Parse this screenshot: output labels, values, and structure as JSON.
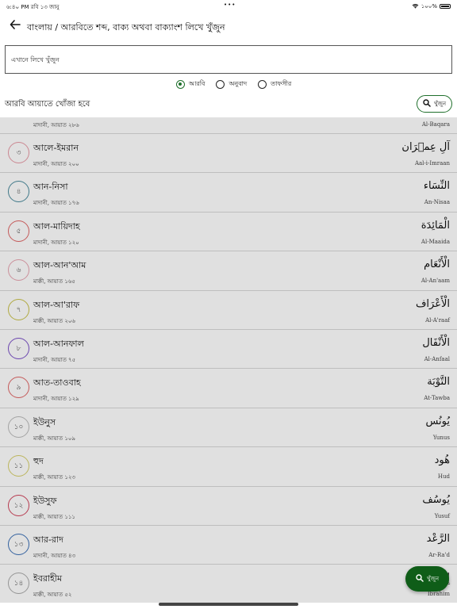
{
  "status_bar": {
    "time": "৬:৪০ PM  রবি ১৩ জানু",
    "dots": "•••",
    "battery": "১০০%"
  },
  "header": {
    "title": "বাংলায় / আরবিতে শব্দ, বাক্য অথবা বাক্যাংশ লিখে খুঁজুন"
  },
  "search": {
    "placeholder": "এখানে লিখে খুঁজুন",
    "value": ""
  },
  "options": [
    {
      "label": "আরবি",
      "selected": true
    },
    {
      "label": "অনুবাদ",
      "selected": false
    },
    {
      "label": "তাফসীর",
      "selected": false
    }
  ],
  "hint": "আরবি আয়াতে খোঁজা হবে",
  "search_button_label": "খুঁজুন",
  "fab_label": "খুঁজুন",
  "partial_row": {
    "meta": "মাদানী, আয়াত ২৮৬",
    "translit": "Al-Baqara"
  },
  "surahs": [
    {
      "number": "৩",
      "name": "আলে-ইমরান",
      "meta": "মাদানী, আয়াত ২০০",
      "arabic": "آلِ عِمۡرَان",
      "translit": "Aal-i-Imraan",
      "color": "#e79aa6"
    },
    {
      "number": "৪",
      "name": "আন-নিসা",
      "meta": "মাদানী, আয়াত ১৭৬",
      "arabic": "النِّسَاء",
      "translit": "An-Nisaa",
      "color": "#4a8a9c"
    },
    {
      "number": "৫",
      "name": "আল-মায়িদাহ",
      "meta": "মাদানী, আয়াত ১২০",
      "arabic": "الْمَائِدَة",
      "translit": "Al-Maaida",
      "color": "#e06666"
    },
    {
      "number": "৬",
      "name": "আল-আন'আম",
      "meta": "মাক্কী, আয়াত ১৬৫",
      "arabic": "الْأَنْعَام",
      "translit": "Al-An'aam",
      "color": "#e7a4b0"
    },
    {
      "number": "৭",
      "name": "আল-আ'রাফ",
      "meta": "মাক্কী, আয়াত ২০৬",
      "arabic": "الْأَعْرَاف",
      "translit": "Al-A'raaf",
      "color": "#c9c14a"
    },
    {
      "number": "৮",
      "name": "আল-আনফাল",
      "meta": "মাদানী, আয়াত ৭৫",
      "arabic": "الْأَنْفَال",
      "translit": "Al-Anfaal",
      "color": "#7a4fc7"
    },
    {
      "number": "৯",
      "name": "আত-তাওবাহ",
      "meta": "মাদানী, আয়াত ১২৯",
      "arabic": "التَّوْبَة",
      "translit": "At-Tawba",
      "color": "#e06666"
    },
    {
      "number": "১০",
      "name": "ইউনুস",
      "meta": "মাক্কী, আয়াত ১০৯",
      "arabic": "يُونُس",
      "translit": "Yunus",
      "color": "#bbbbbb"
    },
    {
      "number": "১১",
      "name": "হুদ",
      "meta": "মাক্কী, আয়াত ১২৩",
      "arabic": "هُود",
      "translit": "Hud",
      "color": "#d6cf6a"
    },
    {
      "number": "১২",
      "name": "ইউসুফ",
      "meta": "মাক্কী, আয়াত ১১১",
      "arabic": "يُوسُف",
      "translit": "Yusuf",
      "color": "#d0435a"
    },
    {
      "number": "১৩",
      "name": "আর-রাদ",
      "meta": "মাদানী, আয়াত ৪৩",
      "arabic": "الرَّعْد",
      "translit": "Ar-Ra'd",
      "color": "#3b6fb5"
    },
    {
      "number": "১৪",
      "name": "ইবরাহীম",
      "meta": "মাক্কী, আয়াত ৫২",
      "arabic": "إِبْرَاهِيم",
      "translit": "Ibrahim",
      "color": "#aaaaaa"
    }
  ]
}
